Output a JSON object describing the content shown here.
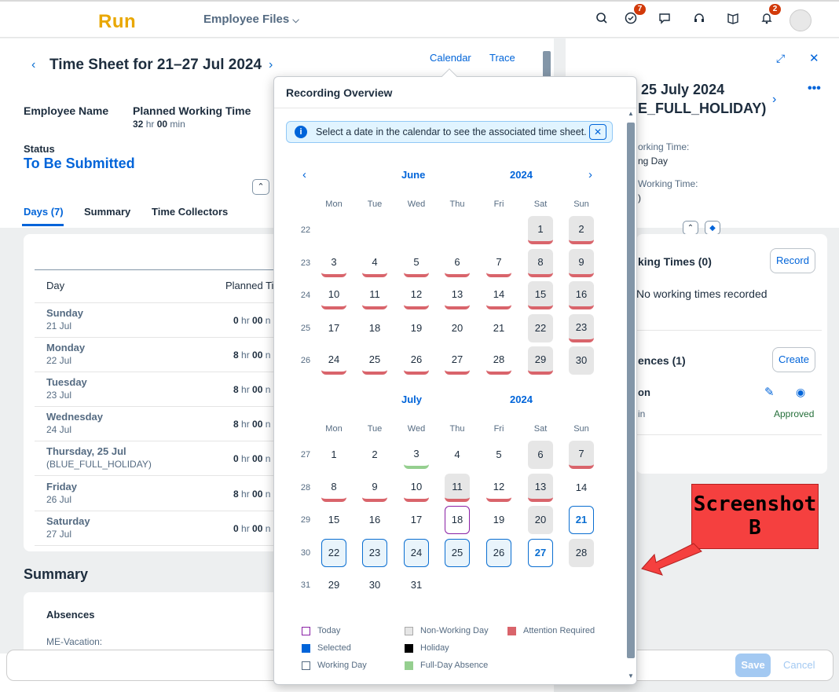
{
  "shell": {
    "logo": "Run",
    "app_nav": "Employee Files",
    "badge_tasks": "7",
    "badge_notifications": "2"
  },
  "timesheet": {
    "title": "Time Sheet for 21–27 Jul 2024",
    "header_links": [
      "Calendar",
      "Trace"
    ],
    "employee_name_label": "Employee Name",
    "planned_label": "Planned Working Time",
    "planned_hr": "32",
    "planned_min": "00",
    "hr_unit": "hr",
    "min_unit": "min",
    "status_label": "Status",
    "status_value": "To Be Submitted",
    "tabs": [
      "Days (7)",
      "Summary",
      "Time Collectors"
    ],
    "table_headers": [
      "Day",
      "Planned Ti"
    ],
    "rows": [
      {
        "day": "Sunday",
        "date": "21 Jul",
        "hr": "0",
        "min": "00"
      },
      {
        "day": "Monday",
        "date": "22 Jul",
        "hr": "8",
        "min": "00"
      },
      {
        "day": "Tuesday",
        "date": "23 Jul",
        "hr": "8",
        "min": "00"
      },
      {
        "day": "Wednesday",
        "date": "24 Jul",
        "hr": "8",
        "min": "00"
      },
      {
        "day": "Thursday, 25 Jul",
        "date": "(BLUE_FULL_HOLIDAY)",
        "hr": "0",
        "min": "00"
      },
      {
        "day": "Friday",
        "date": "26 Jul",
        "hr": "8",
        "min": "00"
      },
      {
        "day": "Saturday",
        "date": "27 Jul",
        "hr": "0",
        "min": "00"
      }
    ],
    "summary_title": "Summary",
    "absences_label": "Absences",
    "me_vacation": "ME-Vacation:"
  },
  "right_panel": {
    "date_title": "25 July 2024",
    "holiday": "E_FULL_HOLIDAY)",
    "wt1": "orking Time:",
    "wt1_val": "ng Day",
    "wt2": "Working Time:",
    "wt2_val": ")",
    "working_times": "king Times (0)",
    "record_btn": "Record",
    "no_times": "No working times recorded",
    "absences": "ences (1)",
    "create_btn": "Create",
    "absence_item": "on",
    "absence_sub": "in",
    "approved": "Approved"
  },
  "footer": {
    "save": "Save",
    "cancel": "Cancel"
  },
  "popover": {
    "title": "Recording Overview",
    "info": "Select a date in the calendar to see the associated time sheet.",
    "weekdays": [
      "Mon",
      "Tue",
      "Wed",
      "Thu",
      "Fri",
      "Sat",
      "Sun"
    ],
    "june": {
      "month": "June",
      "year": "2024",
      "weeks": [
        "22",
        "23",
        "24",
        "25",
        "26"
      ]
    },
    "july": {
      "month": "July",
      "year": "2024",
      "weeks": [
        "27",
        "28",
        "29",
        "30",
        "31"
      ]
    },
    "legend": [
      "Today",
      "Selected",
      "Working Day",
      "Non-Working Day",
      "Holiday",
      "Full-Day Absence",
      "Attention Required"
    ],
    "legend_colors": {
      "today": "#8a20a5",
      "selected": "#0064d9",
      "non_working": "#e6e6e6",
      "holiday": "#000000",
      "full_day": "#95cf8f",
      "attention": "#d9646b"
    }
  },
  "annotation": {
    "line1": "Screenshot",
    "line2": "B"
  }
}
